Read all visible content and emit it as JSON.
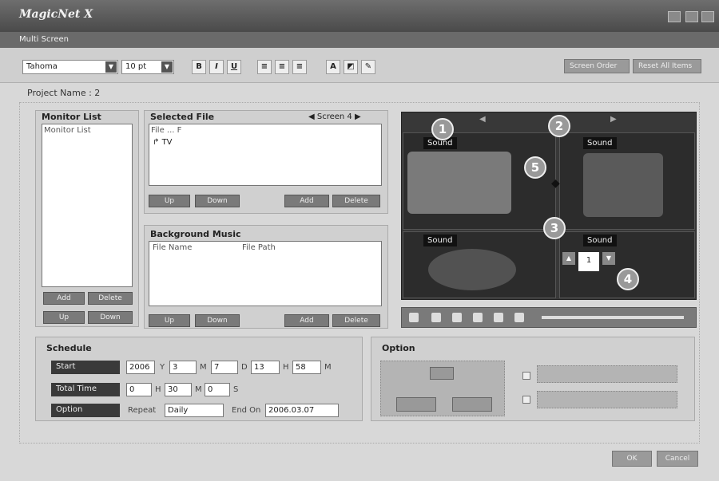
{
  "window": {
    "app_name": "MagicNet X",
    "subtitle": "Multi Screen"
  },
  "toolbar": {
    "font": "Tahoma",
    "size": "10 pt",
    "bold": "B",
    "italic": "I",
    "underline": "U",
    "screen_order": "Screen Order",
    "reset": "Reset All Items"
  },
  "project": {
    "name": "Project Name : 2"
  },
  "monitor_list": {
    "title": "Monitor List",
    "header": "Monitor List",
    "add": "Add",
    "delete": "Delete",
    "up": "Up",
    "down": "Down"
  },
  "selected_file": {
    "title": "Selected File",
    "screen_nav": "◀ Screen 4 ▶",
    "header": "File ... F",
    "item": "TV",
    "up": "Up",
    "down": "Down",
    "add": "Add",
    "delete": "Delete"
  },
  "bg_music": {
    "title": "Background Music",
    "col_name": "File Name",
    "col_path": "File Path",
    "up": "Up",
    "down": "Down",
    "add": "Add",
    "delete": "Delete"
  },
  "viewer": {
    "sound_label": "Sound",
    "n1": "1",
    "n2": "2",
    "n3": "3",
    "n4": "4",
    "n5": "5",
    "spin_value": "1"
  },
  "schedule": {
    "title": "Schedule",
    "start_label": "Start",
    "total_label": "Total Time",
    "option_label": "Option",
    "year": "2006",
    "y": "Y",
    "month": "3",
    "m": "M",
    "day": "7",
    "d": "D",
    "hour": "13",
    "h": "H",
    "minute": "58",
    "mi": "M",
    "t_h": "0",
    "t_h_u": "H",
    "t_m": "30",
    "t_m_u": "M",
    "t_s": "0",
    "t_s_u": "S",
    "repeat_label": "Repeat",
    "repeat_value": "Daily",
    "end_label": "End On",
    "end_value": "2006.03.07"
  },
  "option": {
    "title": "Option"
  },
  "footer": {
    "ok": "OK",
    "cancel": "Cancel"
  }
}
